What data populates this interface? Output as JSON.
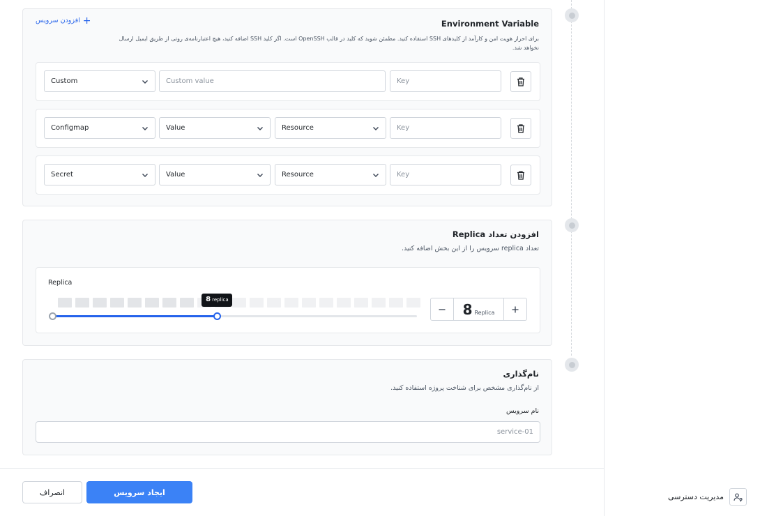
{
  "env": {
    "title": "Environment Variable",
    "add_label": "افزودن سرویس",
    "description": "برای احراز هویت امن و کارآمد از کلیدهای SSH استفاده کنید. مطمئن شوید که کلید در قالب OpenSSH است. اگر کلید SSH اضافه کنید، هیچ اعتبارنامه‌ی روتی از طریق ایمیل ارسال نخواهد شد.",
    "rows": [
      {
        "type": "Custom",
        "custom_placeholder": "Custom value",
        "key_placeholder": "Key"
      },
      {
        "type": "Configmap",
        "value": "Value",
        "resource": "Resource",
        "key_placeholder": "Key"
      },
      {
        "type": "Secret",
        "value": "Value",
        "resource": "Resource",
        "key_placeholder": "Key"
      }
    ]
  },
  "replica": {
    "title": "افزودن تعداد Replica",
    "description": "تعداد replica سرویس را از این بخش اضافه کنید.",
    "label": "Replica",
    "value": "8",
    "unit": "Replica",
    "tooltip_value": "8",
    "tooltip_unit": "replica",
    "slider_fraction": 0.452,
    "bar_count": 21,
    "bars_active": 8
  },
  "naming": {
    "title": "نام‌گذاری",
    "description": "از نام‌گذاری مشخص برای شناخت پروژه استفاده کنید.",
    "field_label": "نام سرویس",
    "placeholder": "service-01"
  },
  "footer": {
    "cancel_label": "انصراف",
    "create_label": "ایجاد سرویس"
  },
  "sidebar": {
    "access_label": "مدیریت دسترسی",
    "access_icon": "user-key-icon"
  },
  "colors": {
    "accent": "#2563eb",
    "primary_button": "#3b82f6"
  }
}
